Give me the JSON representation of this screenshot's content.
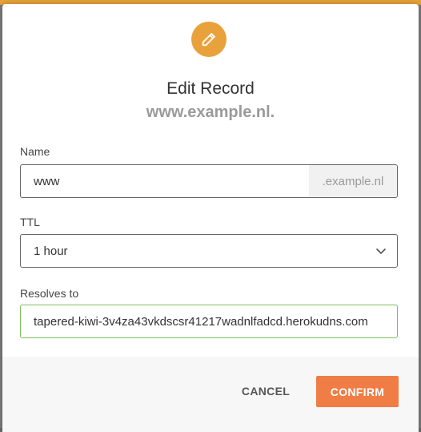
{
  "dialog": {
    "title": "Edit Record",
    "subtitle": "www.example.nl.",
    "icon": "pencil-icon",
    "accent_color": "#e9a23b"
  },
  "form": {
    "name_label": "Name",
    "name_value": "www",
    "name_suffix": ".example.nl",
    "ttl_label": "TTL",
    "ttl_value": "1 hour",
    "resolves_label": "Resolves to",
    "resolves_value": "tapered-kiwi-3v4za43vkdscsr41217wadnlfadcd.herokudns.com"
  },
  "footer": {
    "cancel_label": "CANCEL",
    "confirm_label": "CONFIRM",
    "confirm_color": "#ef7d45"
  }
}
